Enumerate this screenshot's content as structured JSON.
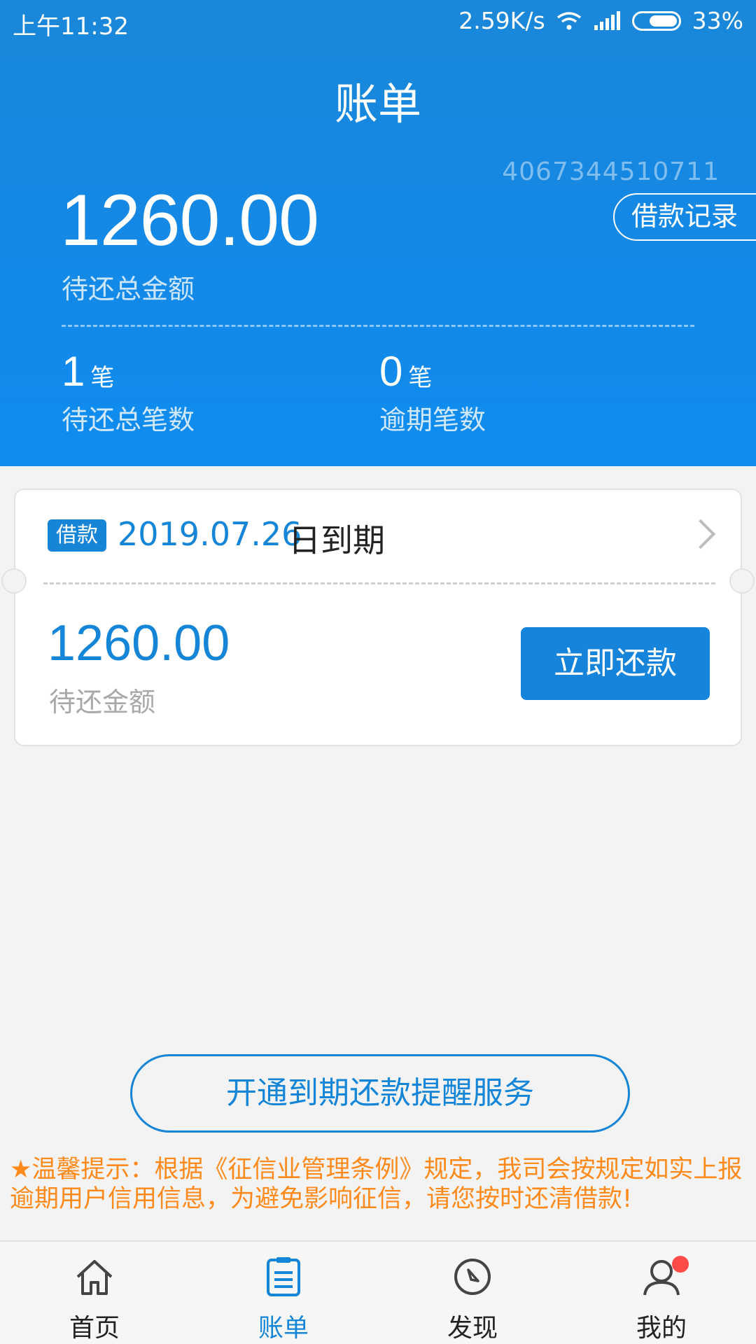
{
  "status_bar": {
    "time": "上午11:32",
    "speed": "2.59K/s",
    "battery": "33%",
    "battery_level": 0.33
  },
  "header": {
    "title": "账单",
    "account_no": "4067344510711",
    "loan_record_label": "借款记录",
    "total_amount": "1260.00",
    "total_label": "待还总金额",
    "stats": [
      {
        "count": "1",
        "unit": "笔",
        "label": "待还总笔数"
      },
      {
        "count": "0",
        "unit": "笔",
        "label": "逾期笔数"
      }
    ]
  },
  "bill_card": {
    "badge": "借款",
    "due_date": "2019.07.26",
    "due_suffix": "日到期",
    "amount": "1260.00",
    "amount_label": "待还金额",
    "pay_button": "立即还款"
  },
  "reminder_button": "开通到期还款提醒服务",
  "tip": "★温馨提示：根据《征信业管理条例》规定，我司会按规定如实上报逾期用户信用信息，为避免影响征信，请您按时还清借款!",
  "tabbar": [
    {
      "label": "首页",
      "icon": "home-icon",
      "active": false
    },
    {
      "label": "账单",
      "icon": "bill-icon",
      "active": true
    },
    {
      "label": "发现",
      "icon": "compass-icon",
      "active": false
    },
    {
      "label": "我的",
      "icon": "user-icon",
      "active": false
    }
  ],
  "colors": {
    "primary": "#1585d8",
    "warning": "#ff8a1c",
    "badge_dot": "#ff4a4a"
  }
}
